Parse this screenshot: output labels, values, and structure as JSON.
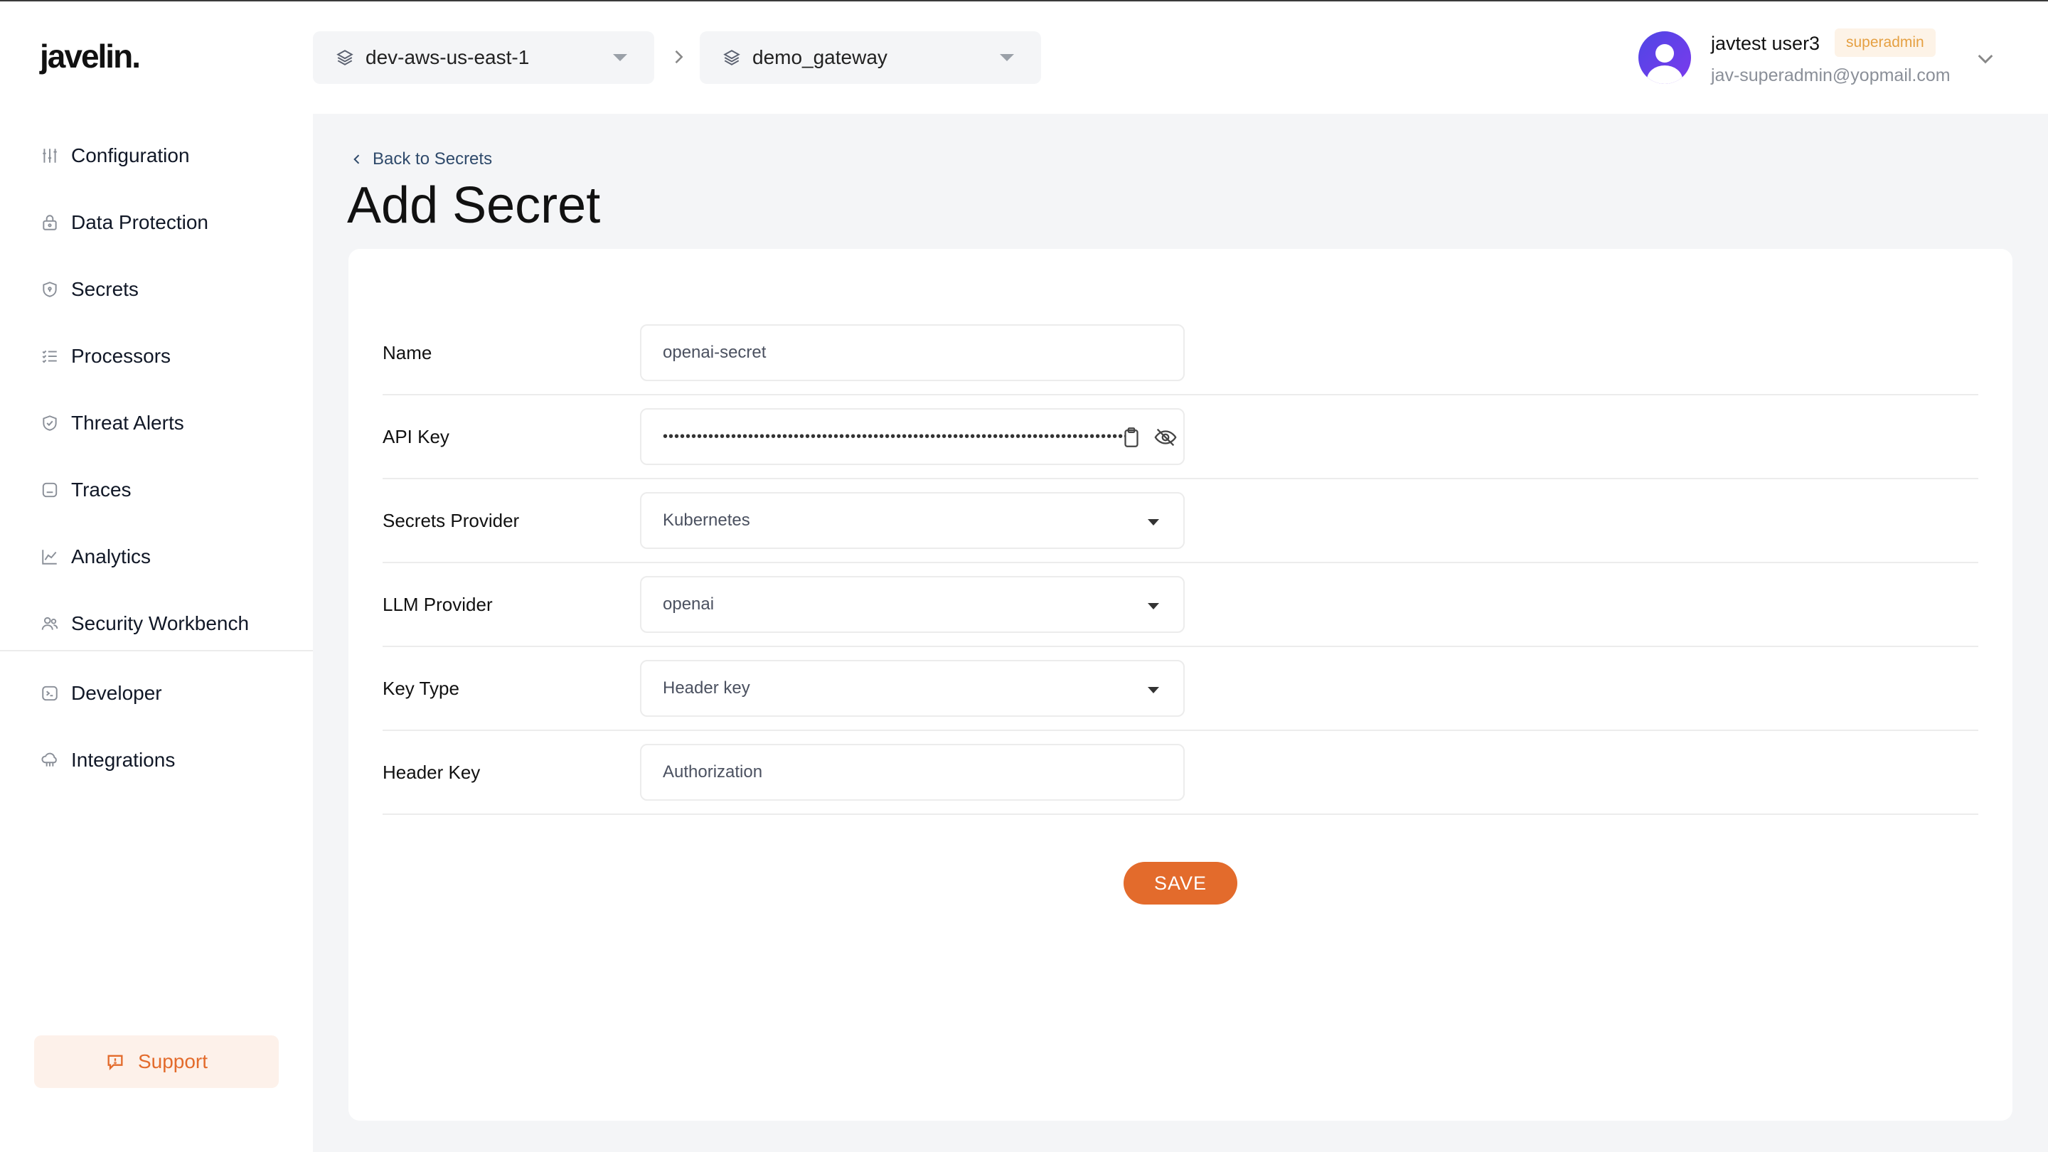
{
  "app": {
    "logo": "javelin."
  },
  "sidebar": {
    "items": [
      {
        "label": "Configuration",
        "icon": "sliders-icon"
      },
      {
        "label": "Data Protection",
        "icon": "lock-icon"
      },
      {
        "label": "Secrets",
        "icon": "shield-icon"
      },
      {
        "label": "Processors",
        "icon": "list-check-icon"
      },
      {
        "label": "Threat Alerts",
        "icon": "shield-check-icon"
      },
      {
        "label": "Traces",
        "icon": "square-icon"
      },
      {
        "label": "Analytics",
        "icon": "line-chart-icon"
      },
      {
        "label": "Security Workbench",
        "icon": "users-icon"
      }
    ],
    "items2": [
      {
        "label": "Developer",
        "icon": "terminal-icon"
      },
      {
        "label": "Integrations",
        "icon": "cloud-icon"
      }
    ],
    "support_label": "Support"
  },
  "header": {
    "environment": "dev-aws-us-east-1",
    "gateway": "demo_gateway",
    "user": {
      "name": "javtest user3",
      "role": "superadmin",
      "email": "jav-superadmin@yopmail.com"
    }
  },
  "page": {
    "back_label": "Back to Secrets",
    "title": "Add Secret"
  },
  "form": {
    "name": {
      "label": "Name",
      "value": "openai-secret"
    },
    "api_key": {
      "label": "API Key",
      "value": "••••••••••••••••••••••••••••••••••••••••••••••••••••••••••••••••••••••••••••••••••••"
    },
    "secrets_provider": {
      "label": "Secrets Provider",
      "value": "Kubernetes"
    },
    "llm_provider": {
      "label": "LLM Provider",
      "value": "openai"
    },
    "key_type": {
      "label": "Key Type",
      "value": "Header key"
    },
    "header_key": {
      "label": "Header Key",
      "value": "Authorization"
    },
    "save_label": "SAVE"
  },
  "colors": {
    "accent": "#e36b2c",
    "badge_bg": "#fdf3e7",
    "badge_text": "#e5a042",
    "link": "#2f4a6b",
    "main_bg": "#f4f5f7"
  }
}
